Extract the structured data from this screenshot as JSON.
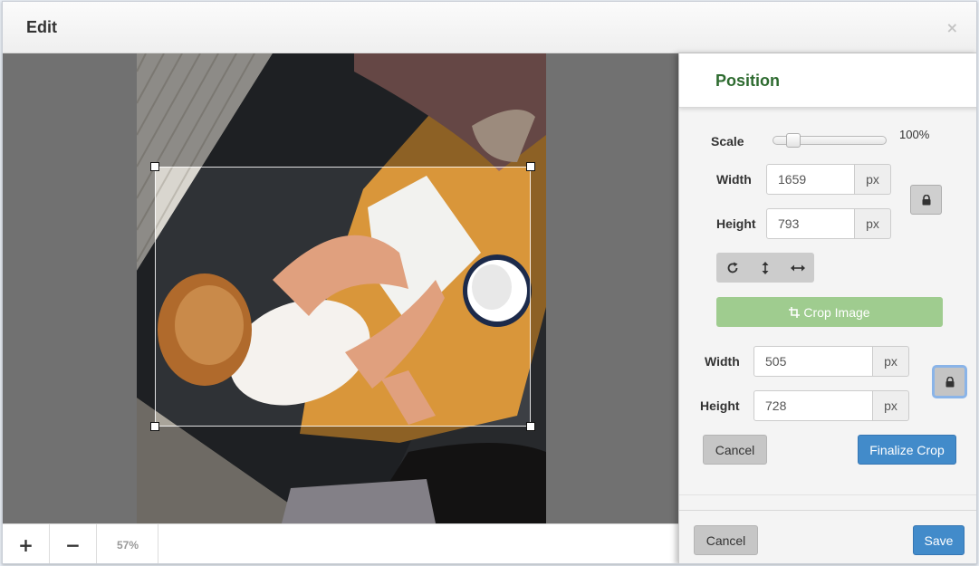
{
  "modal": {
    "title": "Edit",
    "close_label": "×"
  },
  "canvas": {
    "zoom_in_label": "+",
    "zoom_out_label": "−",
    "zoom_level": "57%"
  },
  "panel": {
    "title": "Position",
    "scale": {
      "label": "Scale",
      "value_text": "100%",
      "value": 0.12
    },
    "image_size": {
      "width_label": "Width",
      "width_value": "1659",
      "width_unit": "px",
      "height_label": "Height",
      "height_value": "793",
      "height_unit": "px"
    },
    "tools": [
      "rotate-icon",
      "flip-vertical-icon",
      "flip-horizontal-icon"
    ],
    "crop_image_label": "Crop Image",
    "crop_size": {
      "width_label": "Width",
      "width_value": "505",
      "width_unit": "px",
      "height_label": "Height",
      "height_value": "728",
      "height_unit": "px"
    },
    "crop_cancel_label": "Cancel",
    "finalize_label": "Finalize Crop",
    "footer_cancel_label": "Cancel",
    "save_label": "Save"
  },
  "colors": {
    "title_green": "#2e6b30",
    "primary_blue": "#428bca",
    "crop_green": "#9fcc8f",
    "canvas_gray": "#717171"
  }
}
